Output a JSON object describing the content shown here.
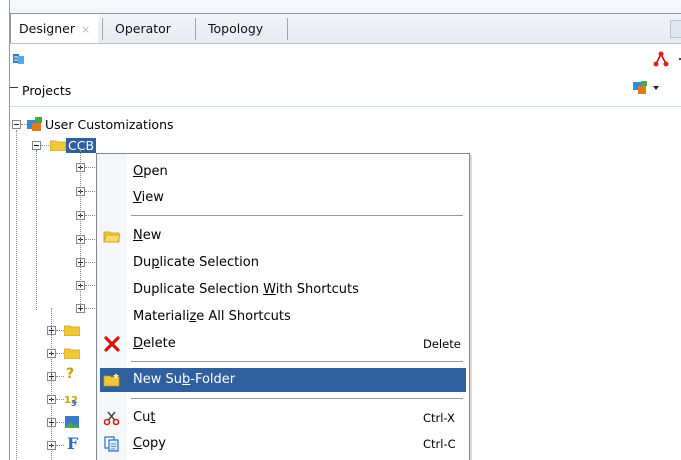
{
  "tabs": [
    {
      "label": "Designer",
      "close": "×",
      "active": true
    },
    {
      "label": "Operator",
      "active": false
    },
    {
      "label": "Topology",
      "active": false
    }
  ],
  "toolbar": {
    "refresh_icon": "refresh-connect-icon",
    "topology_icon": "topology-icon"
  },
  "projects": {
    "label": "Projects",
    "menu_icon": "projects-menu-icon"
  },
  "tree": {
    "root_label": "User Customizations",
    "selected_label": "CCB"
  },
  "context_menu": {
    "items": [
      {
        "pre": "",
        "u": "O",
        "post": "pen",
        "shortcut": ""
      },
      {
        "pre": "",
        "u": "V",
        "post": "iew",
        "shortcut": ""
      },
      {
        "pre": "",
        "u": "N",
        "post": "ew",
        "shortcut": "",
        "icon": "folder-open-icon"
      },
      {
        "pre": "Du",
        "u": "p",
        "post": "licate Selection",
        "shortcut": ""
      },
      {
        "pre": "Duplicate Selection ",
        "u": "W",
        "post": "ith Shortcuts",
        "shortcut": ""
      },
      {
        "pre": "Materiali",
        "u": "z",
        "post": "e All Shortcuts",
        "shortcut": ""
      },
      {
        "pre": "",
        "u": "D",
        "post": "elete",
        "shortcut": "Delete",
        "icon": "delete-x-icon"
      },
      {
        "pre": "New Su",
        "u": "b",
        "post": "-Folder",
        "shortcut": "",
        "icon": "new-folder-icon",
        "highlighted": true
      },
      {
        "pre": "Cu",
        "u": "t",
        "post": "",
        "shortcut": "Ctrl-X",
        "icon": "scissors-icon"
      },
      {
        "pre": "",
        "u": "C",
        "post": "opy",
        "shortcut": "Ctrl-C",
        "icon": "copy-icon"
      }
    ]
  },
  "colors": {
    "selection": "#2f5f9c",
    "border": "#8e9aa8"
  }
}
